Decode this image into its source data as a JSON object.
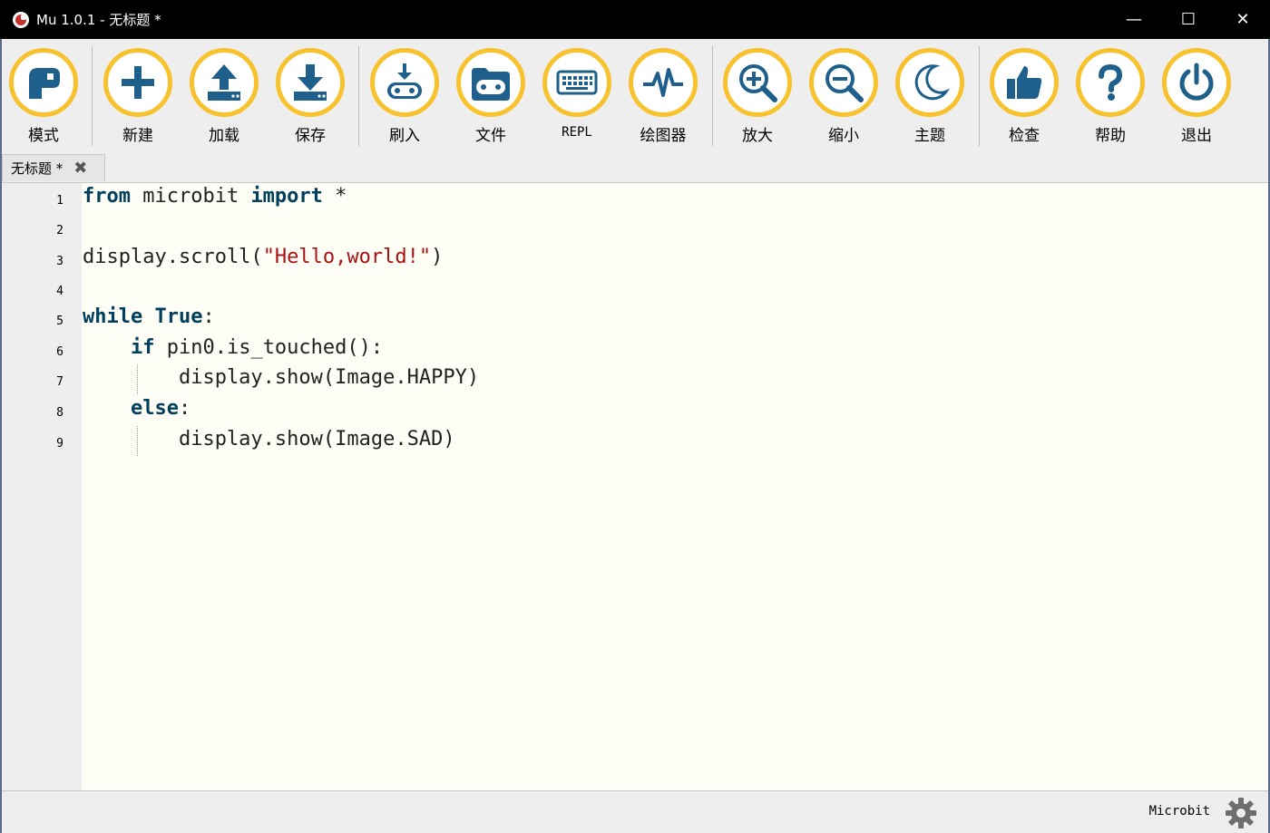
{
  "window": {
    "title": "Mu 1.0.1 - 无标题 *",
    "minimize": "—",
    "maximize": "☐",
    "close": "✕"
  },
  "toolbar": {
    "buttons": [
      {
        "id": "mode",
        "label": "模式",
        "icon": "mode-icon"
      },
      {
        "id": "new",
        "label": "新建",
        "icon": "plus-icon"
      },
      {
        "id": "load",
        "label": "加载",
        "icon": "upload-icon"
      },
      {
        "id": "save",
        "label": "保存",
        "icon": "download-icon"
      },
      {
        "id": "flash",
        "label": "刷入",
        "icon": "flash-icon"
      },
      {
        "id": "files",
        "label": "文件",
        "icon": "folder-icon"
      },
      {
        "id": "repl",
        "label": "REPL",
        "icon": "keyboard-icon"
      },
      {
        "id": "plotter",
        "label": "绘图器",
        "icon": "pulse-icon"
      },
      {
        "id": "zoom-in",
        "label": "放大",
        "icon": "zoom-in-icon"
      },
      {
        "id": "zoom-out",
        "label": "缩小",
        "icon": "zoom-out-icon"
      },
      {
        "id": "theme",
        "label": "主题",
        "icon": "moon-icon"
      },
      {
        "id": "check",
        "label": "检查",
        "icon": "thumbs-up-icon"
      },
      {
        "id": "help",
        "label": "帮助",
        "icon": "question-icon"
      },
      {
        "id": "quit",
        "label": "退出",
        "icon": "power-icon"
      }
    ]
  },
  "tabs": [
    {
      "label": "无标题 *",
      "close": "✖"
    }
  ],
  "editor": {
    "lines": [
      {
        "n": "1",
        "text": "from microbit import *"
      },
      {
        "n": "2",
        "text": ""
      },
      {
        "n": "3",
        "text": "display.scroll(\"Hello,world!\")"
      },
      {
        "n": "4",
        "text": ""
      },
      {
        "n": "5",
        "text": "while True:"
      },
      {
        "n": "6",
        "text": "    if pin0.is_touched():"
      },
      {
        "n": "7",
        "text": "        display.show(Image.HAPPY)"
      },
      {
        "n": "8",
        "text": "    else:"
      },
      {
        "n": "9",
        "text": "        display.show(Image.SAD)"
      }
    ]
  },
  "status": {
    "mode": "Microbit",
    "settings_icon": "gear-icon"
  },
  "colors": {
    "button_ring": "#f7c22d",
    "icon": "#1f5f8b",
    "keyword": "#00405d",
    "string": "#aa1111",
    "editor_bg": "#fefdf6"
  }
}
